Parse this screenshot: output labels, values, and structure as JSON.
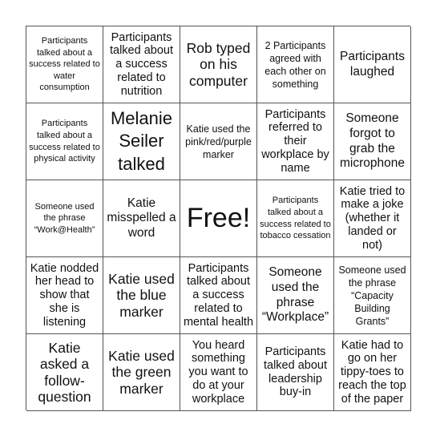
{
  "board": {
    "rows": [
      [
        {
          "text": "Participants talked about a success related to water consumption",
          "size": "xs"
        },
        {
          "text": "Participants talked about a success related to nutrition",
          "size": "md"
        },
        {
          "text": "Rob typed on his computer",
          "size": "xl"
        },
        {
          "text": "2 Participants agreed with each other on something",
          "size": "sm"
        },
        {
          "text": "Participants laughed",
          "size": "lg"
        }
      ],
      [
        {
          "text": "Participants talked about a success related to physical activity",
          "size": "xs"
        },
        {
          "text": "Melanie Seiler talked",
          "size": "xxl"
        },
        {
          "text": "Katie used the pink/red/purple marker",
          "size": "sm"
        },
        {
          "text": "Participants referred to their workplace by name",
          "size": "md"
        },
        {
          "text": "Someone forgot to grab the microphone",
          "size": "lg"
        }
      ],
      [
        {
          "text": "Someone used the phrase “Work@Health”",
          "size": "xs"
        },
        {
          "text": "Katie misspelled a word",
          "size": "lg"
        },
        {
          "text": "Free!",
          "size": "free"
        },
        {
          "text": "Participants talked about a success related to tobacco cessation",
          "size": "xs"
        },
        {
          "text": "Katie tried to make a joke (whether it landed or not)",
          "size": "md"
        }
      ],
      [
        {
          "text": "Katie nodded her head to show that she is listening",
          "size": "md"
        },
        {
          "text": "Katie used the blue marker",
          "size": "xl"
        },
        {
          "text": "Participants talked about a success related to mental health",
          "size": "md"
        },
        {
          "text": "Someone used the phrase “Workplace”",
          "size": "lg"
        },
        {
          "text": "Someone used the phrase “Capacity Building Grants”",
          "size": "sm"
        }
      ],
      [
        {
          "text": "Katie asked a follow-question",
          "size": "xl"
        },
        {
          "text": "Katie used the green marker",
          "size": "xl"
        },
        {
          "text": "You heard something you want to do at your workplace",
          "size": "md"
        },
        {
          "text": "Participants talked about leadership buy-in",
          "size": "md"
        },
        {
          "text": "Katie had to go on her tippy-toes to reach the top of the paper",
          "size": "md"
        }
      ]
    ]
  }
}
